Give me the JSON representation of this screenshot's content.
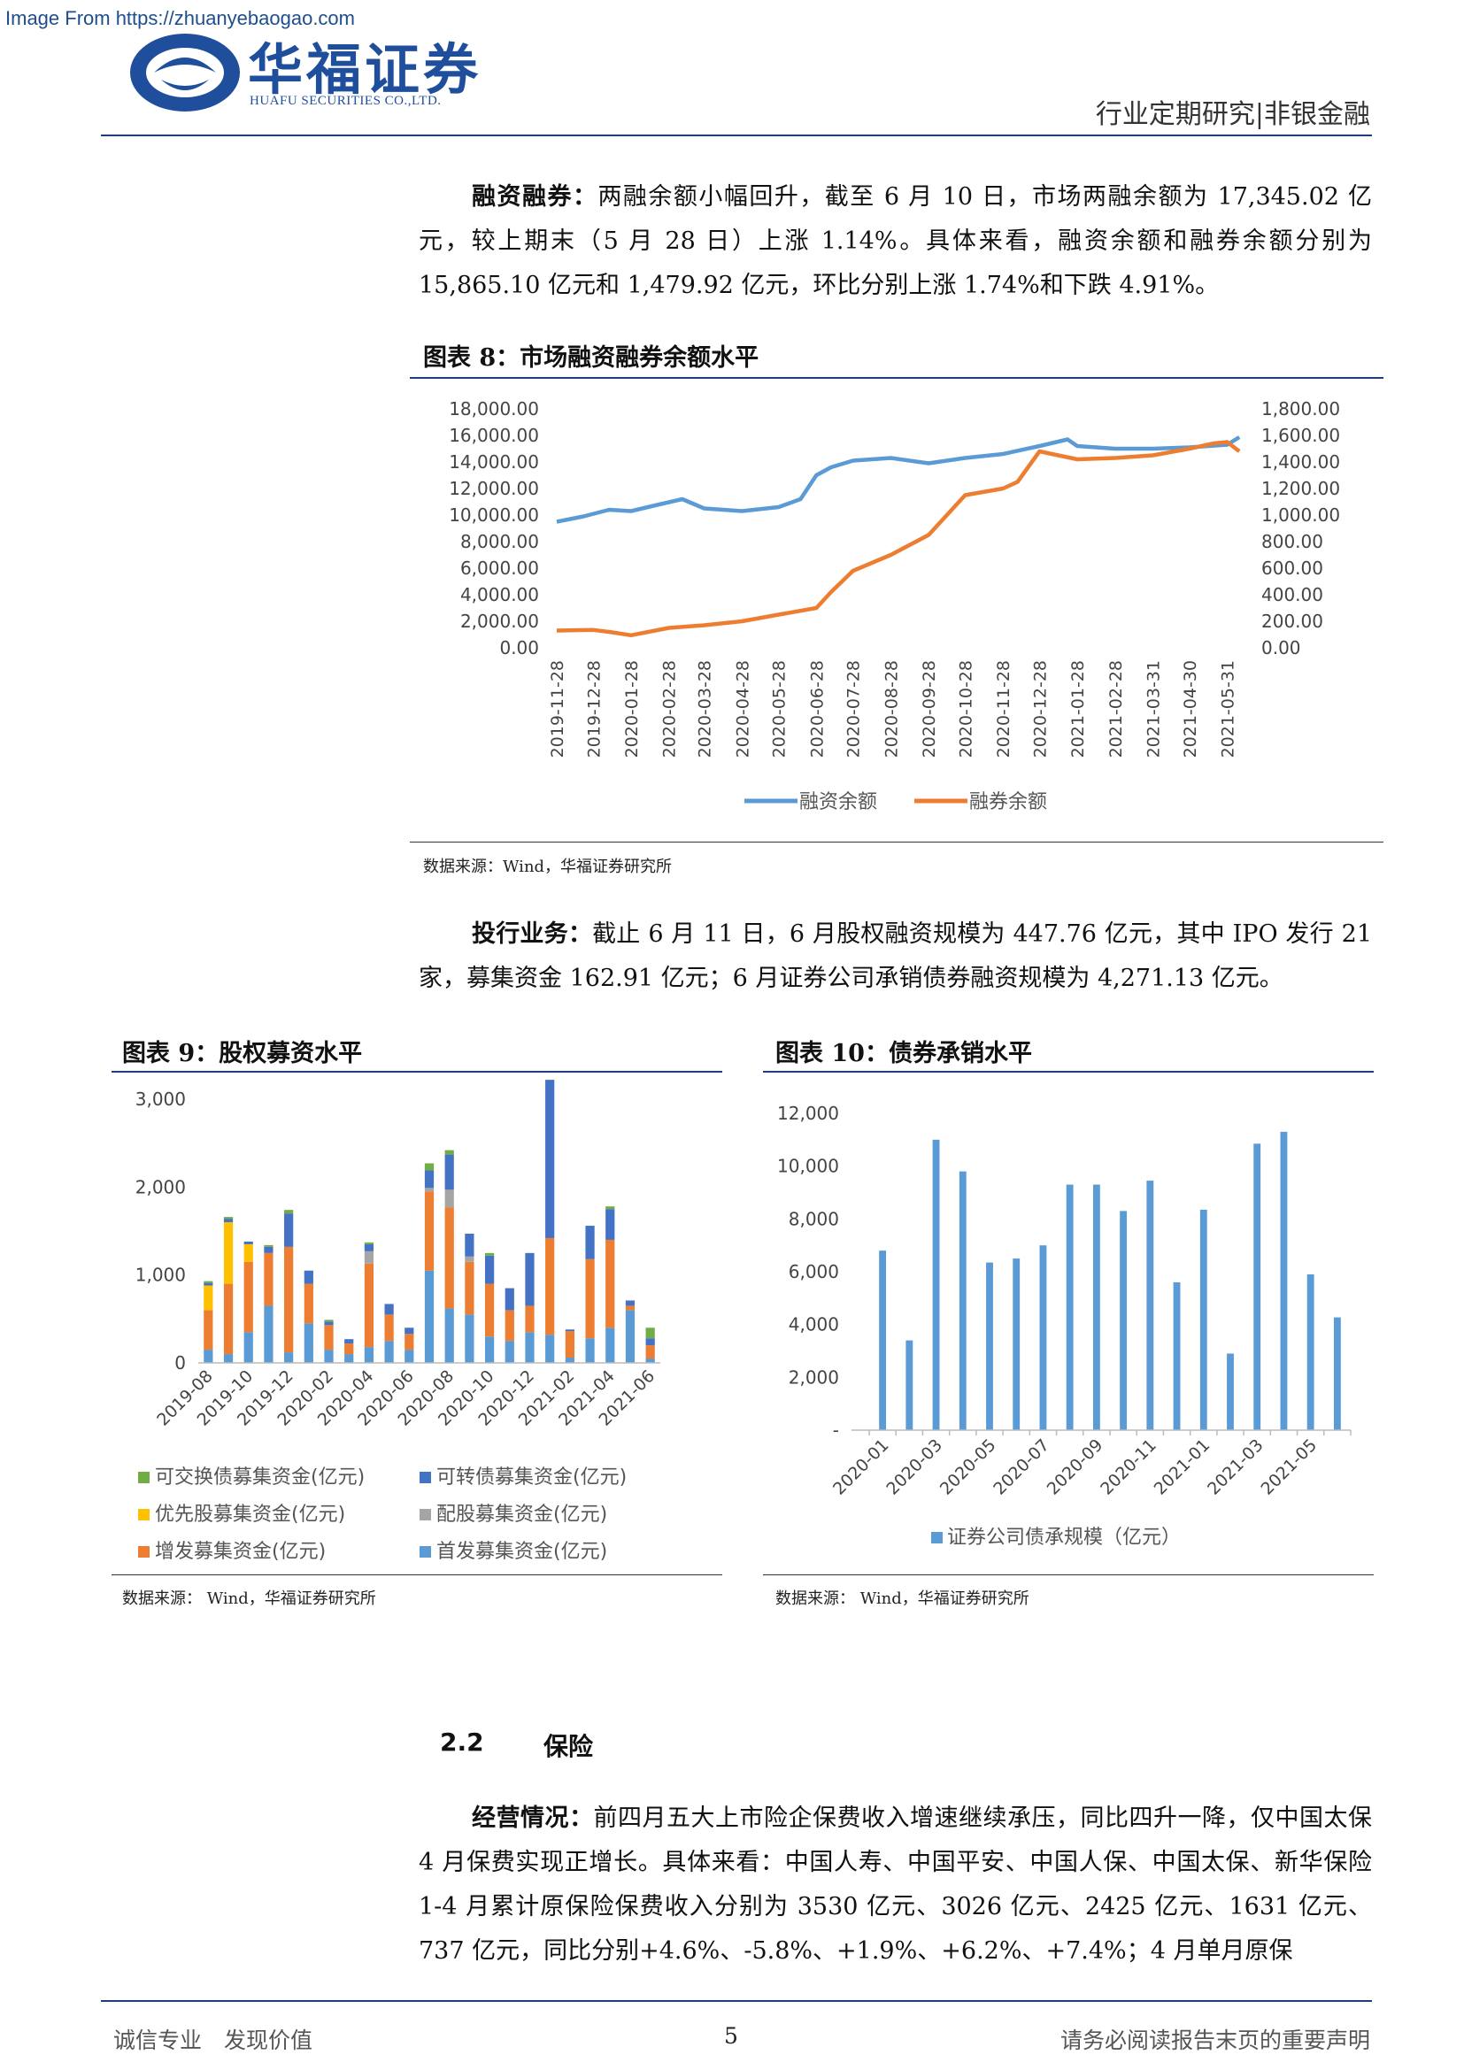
{
  "header": {
    "watermark": "Image From https://zhuanyebaogao.com",
    "logo_cn": "华福证券",
    "logo_en": "HUAFU SECURITIES CO.,LTD.",
    "report_type": "行业定期研究|非银金融"
  },
  "p1": {
    "lead": "融资融券：",
    "text": "两融余额小幅回升，截至 6 月 10 日，市场两融余额为 17,345.02 亿元，较上期末（5 月 28 日）上涨 1.14%。具体来看，融资余额和融券余额分别为 15,865.10 亿元和 1,479.92 亿元，环比分别上涨 1.74%和下跌 4.91%。"
  },
  "fig8": {
    "title": "图表 8：市场融资融券余额水平",
    "source": "数据来源：Wind，华福证券研究所"
  },
  "p2": {
    "lead": "投行业务：",
    "text": "截止 6 月 11 日，6 月股权融资规模为 447.76 亿元，其中 IPO 发行 21 家，募集资金 162.91 亿元；6 月证券公司承销债券融资规模为 4,271.13 亿元。"
  },
  "fig9": {
    "title": "图表 9：股权募资水平",
    "source": "数据来源： Wind，华福证券研究所"
  },
  "fig10": {
    "title": "图表 10：债券承销水平",
    "source": "数据来源： Wind，华福证券研究所"
  },
  "section": {
    "num": "2.2",
    "title": "保险"
  },
  "p3": {
    "lead": "经营情况：",
    "text": "前四月五大上市险企保费收入增速继续承压，同比四升一降，仅中国太保 4 月保费实现正增长。具体来看：中国人寿、中国平安、中国人保、中国太保、新华保险 1-4 月累计原保险保费收入分别为 3530 亿元、3026 亿元、2425 亿元、1631 亿元、737 亿元，同比分别+4.6%、-5.8%、+1.9%、+6.2%、+7.4%；4 月单月原保"
  },
  "footer": {
    "left": "诚信专业　发现价值",
    "page": "5",
    "right": "请务必阅读报告末页的重要声明"
  },
  "colors": {
    "blue": "#5b9bd5",
    "orange": "#ed7d31",
    "gray": "#a5a5a5",
    "yellow": "#ffc000",
    "navy": "#4472c4",
    "green": "#70ad47"
  },
  "chart_data": [
    {
      "type": "line",
      "title": "",
      "x_ticks": [
        "2019-11-28",
        "2019-12-28",
        "2020-01-28",
        "2020-02-28",
        "2020-03-28",
        "2020-04-28",
        "2020-05-28",
        "2020-06-28",
        "2020-07-28",
        "2020-08-28",
        "2020-09-28",
        "2020-10-28",
        "2020-11-28",
        "2020-12-28",
        "2021-01-28",
        "2021-02-28",
        "2021-03-31",
        "2021-04-30",
        "2021-05-31"
      ],
      "y_left_ticks": [
        "18,000.00",
        "16,000.00",
        "14,000.00",
        "12,000.00",
        "10,000.00",
        "8,000.00",
        "6,000.00",
        "4,000.00",
        "2,000.00",
        "0.00"
      ],
      "y_right_ticks": [
        "1,800.00",
        "1,600.00",
        "1,400.00",
        "1,200.00",
        "1,000.00",
        "800.00",
        "600.00",
        "400.00",
        "200.00",
        "0.00"
      ],
      "ylim_left": [
        0,
        18000
      ],
      "ylim_right": [
        0,
        1800
      ],
      "legend_position": "bottom",
      "series": [
        {
          "name": "融资余额",
          "axis": "left",
          "color": "#5b9bd5",
          "x": [
            "2019-11-28",
            "2019-12-20",
            "2020-01-10",
            "2020-01-28",
            "2020-02-20",
            "2020-03-10",
            "2020-03-28",
            "2020-04-28",
            "2020-05-28",
            "2020-06-15",
            "2020-06-28",
            "2020-07-10",
            "2020-07-28",
            "2020-08-28",
            "2020-09-28",
            "2020-10-28",
            "2020-11-28",
            "2020-12-28",
            "2021-01-20",
            "2021-01-28",
            "2021-02-28",
            "2021-03-31",
            "2021-04-30",
            "2021-05-31",
            "2021-06-10"
          ],
          "values": [
            9500,
            9900,
            10400,
            10300,
            10800,
            11200,
            10500,
            10300,
            10600,
            11200,
            13000,
            13600,
            14100,
            14300,
            13900,
            14300,
            14600,
            15200,
            15700,
            15200,
            15000,
            15000,
            15100,
            15300,
            15865
          ]
        },
        {
          "name": "融券余额",
          "axis": "right",
          "color": "#ed7d31",
          "x": [
            "2019-11-28",
            "2019-12-28",
            "2020-01-10",
            "2020-01-28",
            "2020-02-28",
            "2020-03-28",
            "2020-04-28",
            "2020-05-28",
            "2020-06-28",
            "2020-07-10",
            "2020-07-28",
            "2020-08-28",
            "2020-09-28",
            "2020-10-28",
            "2020-11-28",
            "2020-12-10",
            "2020-12-28",
            "2021-01-28",
            "2021-02-28",
            "2021-03-31",
            "2021-04-30",
            "2021-05-20",
            "2021-05-31",
            "2021-06-10"
          ],
          "values": [
            130,
            135,
            120,
            95,
            150,
            170,
            200,
            250,
            300,
            420,
            580,
            700,
            850,
            1150,
            1200,
            1250,
            1480,
            1420,
            1430,
            1450,
            1500,
            1540,
            1550,
            1480
          ]
        }
      ]
    },
    {
      "type": "bar",
      "stacked": true,
      "title": "",
      "categories": [
        "2019-08",
        "2019-09",
        "2019-10",
        "2019-11",
        "2019-12",
        "2020-01",
        "2020-02",
        "2020-03",
        "2020-04",
        "2020-05",
        "2020-06",
        "2020-07",
        "2020-08",
        "2020-09",
        "2020-10",
        "2020-11",
        "2020-12",
        "2021-01",
        "2021-02",
        "2021-03",
        "2021-04",
        "2021-05",
        "2021-06"
      ],
      "x_tick_labels": [
        "2019-08",
        "2019-10",
        "2019-12",
        "2020-02",
        "2020-04",
        "2020-06",
        "2020-08",
        "2020-10",
        "2020-12",
        "2021-02",
        "2021-04",
        "2021-06"
      ],
      "y_ticks": [
        "3,000",
        "2,000",
        "1,000",
        "0"
      ],
      "ylim": [
        0,
        3000
      ],
      "legend_position": "bottom",
      "series": [
        {
          "name": "首发募集资金(亿元)",
          "color": "#5b9bd5",
          "values": [
            150,
            100,
            350,
            650,
            120,
            450,
            150,
            100,
            180,
            250,
            150,
            1050,
            620,
            550,
            300,
            250,
            350,
            320,
            60,
            280,
            400,
            600,
            50
          ]
        },
        {
          "name": "增发募集资金(亿元)",
          "color": "#ed7d31",
          "values": [
            450,
            800,
            800,
            600,
            1200,
            450,
            280,
            120,
            950,
            300,
            180,
            900,
            1150,
            600,
            600,
            350,
            300,
            1100,
            300,
            900,
            1000,
            50,
            150
          ]
        },
        {
          "name": "配股募集资金(亿元)",
          "color": "#a5a5a5",
          "values": [
            0,
            0,
            0,
            0,
            0,
            0,
            0,
            0,
            140,
            0,
            0,
            40,
            200,
            60,
            0,
            0,
            0,
            0,
            0,
            0,
            0,
            0,
            0
          ]
        },
        {
          "name": "优先股募集资金(亿元)",
          "color": "#ffc000",
          "values": [
            280,
            700,
            200,
            0,
            0,
            0,
            0,
            0,
            0,
            0,
            0,
            0,
            0,
            0,
            0,
            0,
            0,
            0,
            0,
            0,
            0,
            0,
            0
          ]
        },
        {
          "name": "可转债募集资金(亿元)",
          "color": "#4472c4",
          "values": [
            30,
            40,
            30,
            70,
            380,
            150,
            40,
            50,
            80,
            120,
            70,
            200,
            400,
            260,
            320,
            250,
            600,
            1800,
            20,
            380,
            350,
            60,
            80
          ]
        },
        {
          "name": "可交换债募集资金(亿元)",
          "color": "#70ad47",
          "values": [
            20,
            20,
            0,
            20,
            40,
            0,
            20,
            0,
            20,
            0,
            0,
            80,
            50,
            0,
            30,
            0,
            0,
            0,
            0,
            0,
            30,
            0,
            120
          ]
        }
      ]
    },
    {
      "type": "bar",
      "title": "",
      "categories": [
        "2020-01",
        "2020-02",
        "2020-03",
        "2020-04",
        "2020-05",
        "2020-06",
        "2020-07",
        "2020-08",
        "2020-09",
        "2020-10",
        "2020-11",
        "2020-12",
        "2021-01",
        "2021-02",
        "2021-03",
        "2021-04",
        "2021-05",
        "2021-06"
      ],
      "x_tick_labels": [
        "2020-01",
        "2020-03",
        "2020-05",
        "2020-07",
        "2020-09",
        "2020-11",
        "2021-01",
        "2021-03",
        "2021-05"
      ],
      "y_ticks": [
        "12,000",
        "10,000",
        "8,000",
        "6,000",
        "4,000",
        "2,000",
        "-"
      ],
      "ylim": [
        0,
        12000
      ],
      "legend_position": "bottom",
      "series": [
        {
          "name": "证券公司债承规模（亿元）",
          "color": "#5b9bd5",
          "values": [
            6800,
            3400,
            11000,
            9800,
            6350,
            6500,
            7000,
            9300,
            9300,
            8300,
            9450,
            5600,
            8350,
            2900,
            10850,
            11300,
            5900,
            4271
          ]
        }
      ]
    }
  ]
}
